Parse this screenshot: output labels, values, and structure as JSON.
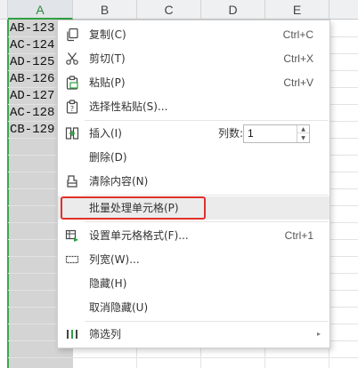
{
  "sheet": {
    "columns": [
      "A",
      "B",
      "C",
      "D",
      "E"
    ],
    "cells_A": [
      "AB-123",
      "AC-124",
      "AD-125",
      "AB-126",
      "AD-127",
      "AC-128",
      "CB-129"
    ]
  },
  "menu": {
    "copy": {
      "label": "复制(C)",
      "shortcut": "Ctrl+C"
    },
    "cut": {
      "label": "剪切(T)",
      "shortcut": "Ctrl+X"
    },
    "paste": {
      "label": "粘贴(P)",
      "shortcut": "Ctrl+V"
    },
    "paste_special": {
      "label": "选择性粘贴(S)..."
    },
    "insert": {
      "label": "插入(I)",
      "count_label": "列数:",
      "count_value": "1"
    },
    "delete": {
      "label": "删除(D)"
    },
    "clear": {
      "label": "清除内容(N)"
    },
    "batch": {
      "label": "批量处理单元格(P)"
    },
    "format": {
      "label": "设置单元格格式(F)...",
      "shortcut": "Ctrl+1"
    },
    "col_width": {
      "label": "列宽(W)..."
    },
    "hide": {
      "label": "隐藏(H)"
    },
    "unhide": {
      "label": "取消隐藏(U)"
    },
    "filter": {
      "label": "筛选列"
    }
  },
  "colors": {
    "selected_column_accent": "#2ea043",
    "highlight_border": "#e0302a"
  }
}
